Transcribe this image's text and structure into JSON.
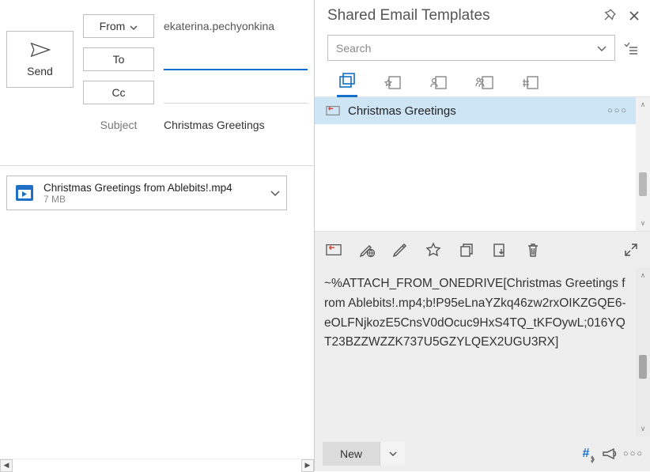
{
  "compose": {
    "send_label": "Send",
    "from_label": "From",
    "to_label": "To",
    "cc_label": "Cc",
    "subject_label": "Subject",
    "from_value": "ekaterina.pechyonkina",
    "to_value": "",
    "cc_value": "",
    "subject_value": "Christmas Greetings",
    "attachment": {
      "name": "Christmas Greetings from Ablebits!.mp4",
      "size": "7 MB"
    }
  },
  "panel": {
    "title": "Shared Email Templates",
    "search_placeholder": "Search",
    "template_list": {
      "items": [
        {
          "name": "Christmas Greetings"
        }
      ]
    },
    "editor_body": "~%ATTACH_FROM_ONEDRIVE[Christmas Greetings from Ablebits!.mp4;b!P95eLnaYZkq46zw2rxOIKZGQE6-eOLFNjkozE5CnsV0dOcuc9HxS4TQ_tKFOywL;016YQT23BZZWZZK737U5GZYLQEX2UGU3RX]",
    "new_button_label": "New"
  }
}
